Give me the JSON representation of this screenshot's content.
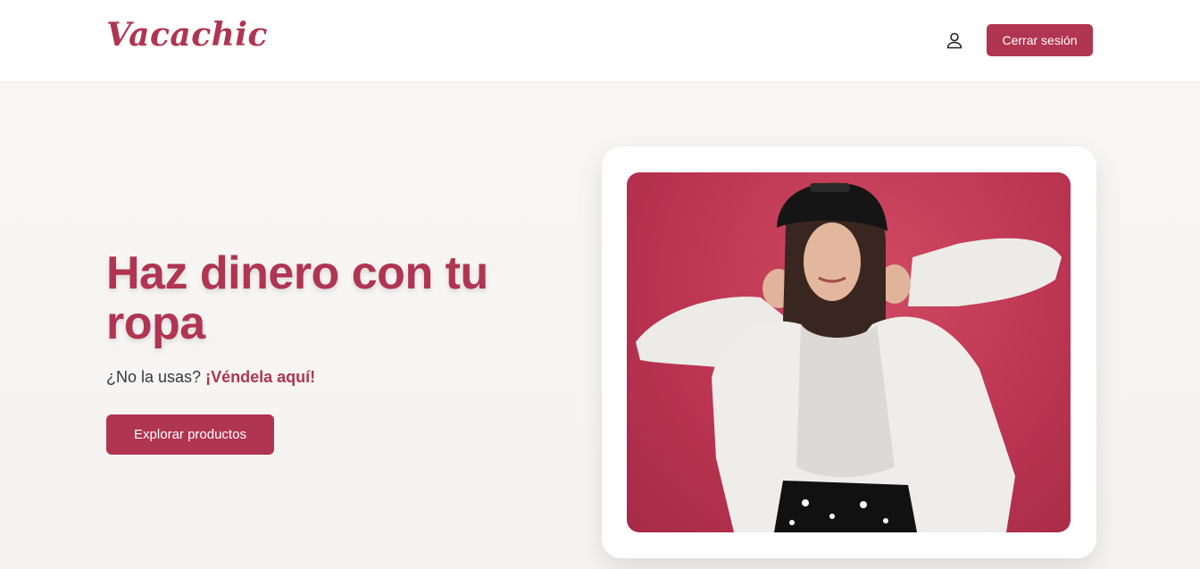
{
  "header": {
    "logo": "Vacachic",
    "user_icon": "user-icon",
    "logout_label": "Cerrar sesión"
  },
  "hero": {
    "title": "Haz dinero con tu ropa",
    "subtitle_plain": "¿No la usas?",
    "subtitle_accent": "¡Véndela aquí!",
    "cta_label": "Explorar productos"
  },
  "colors": {
    "brand": "#b03550",
    "text": "#333a44",
    "background": "#f7f5f4",
    "image_background": "#bc3553"
  }
}
